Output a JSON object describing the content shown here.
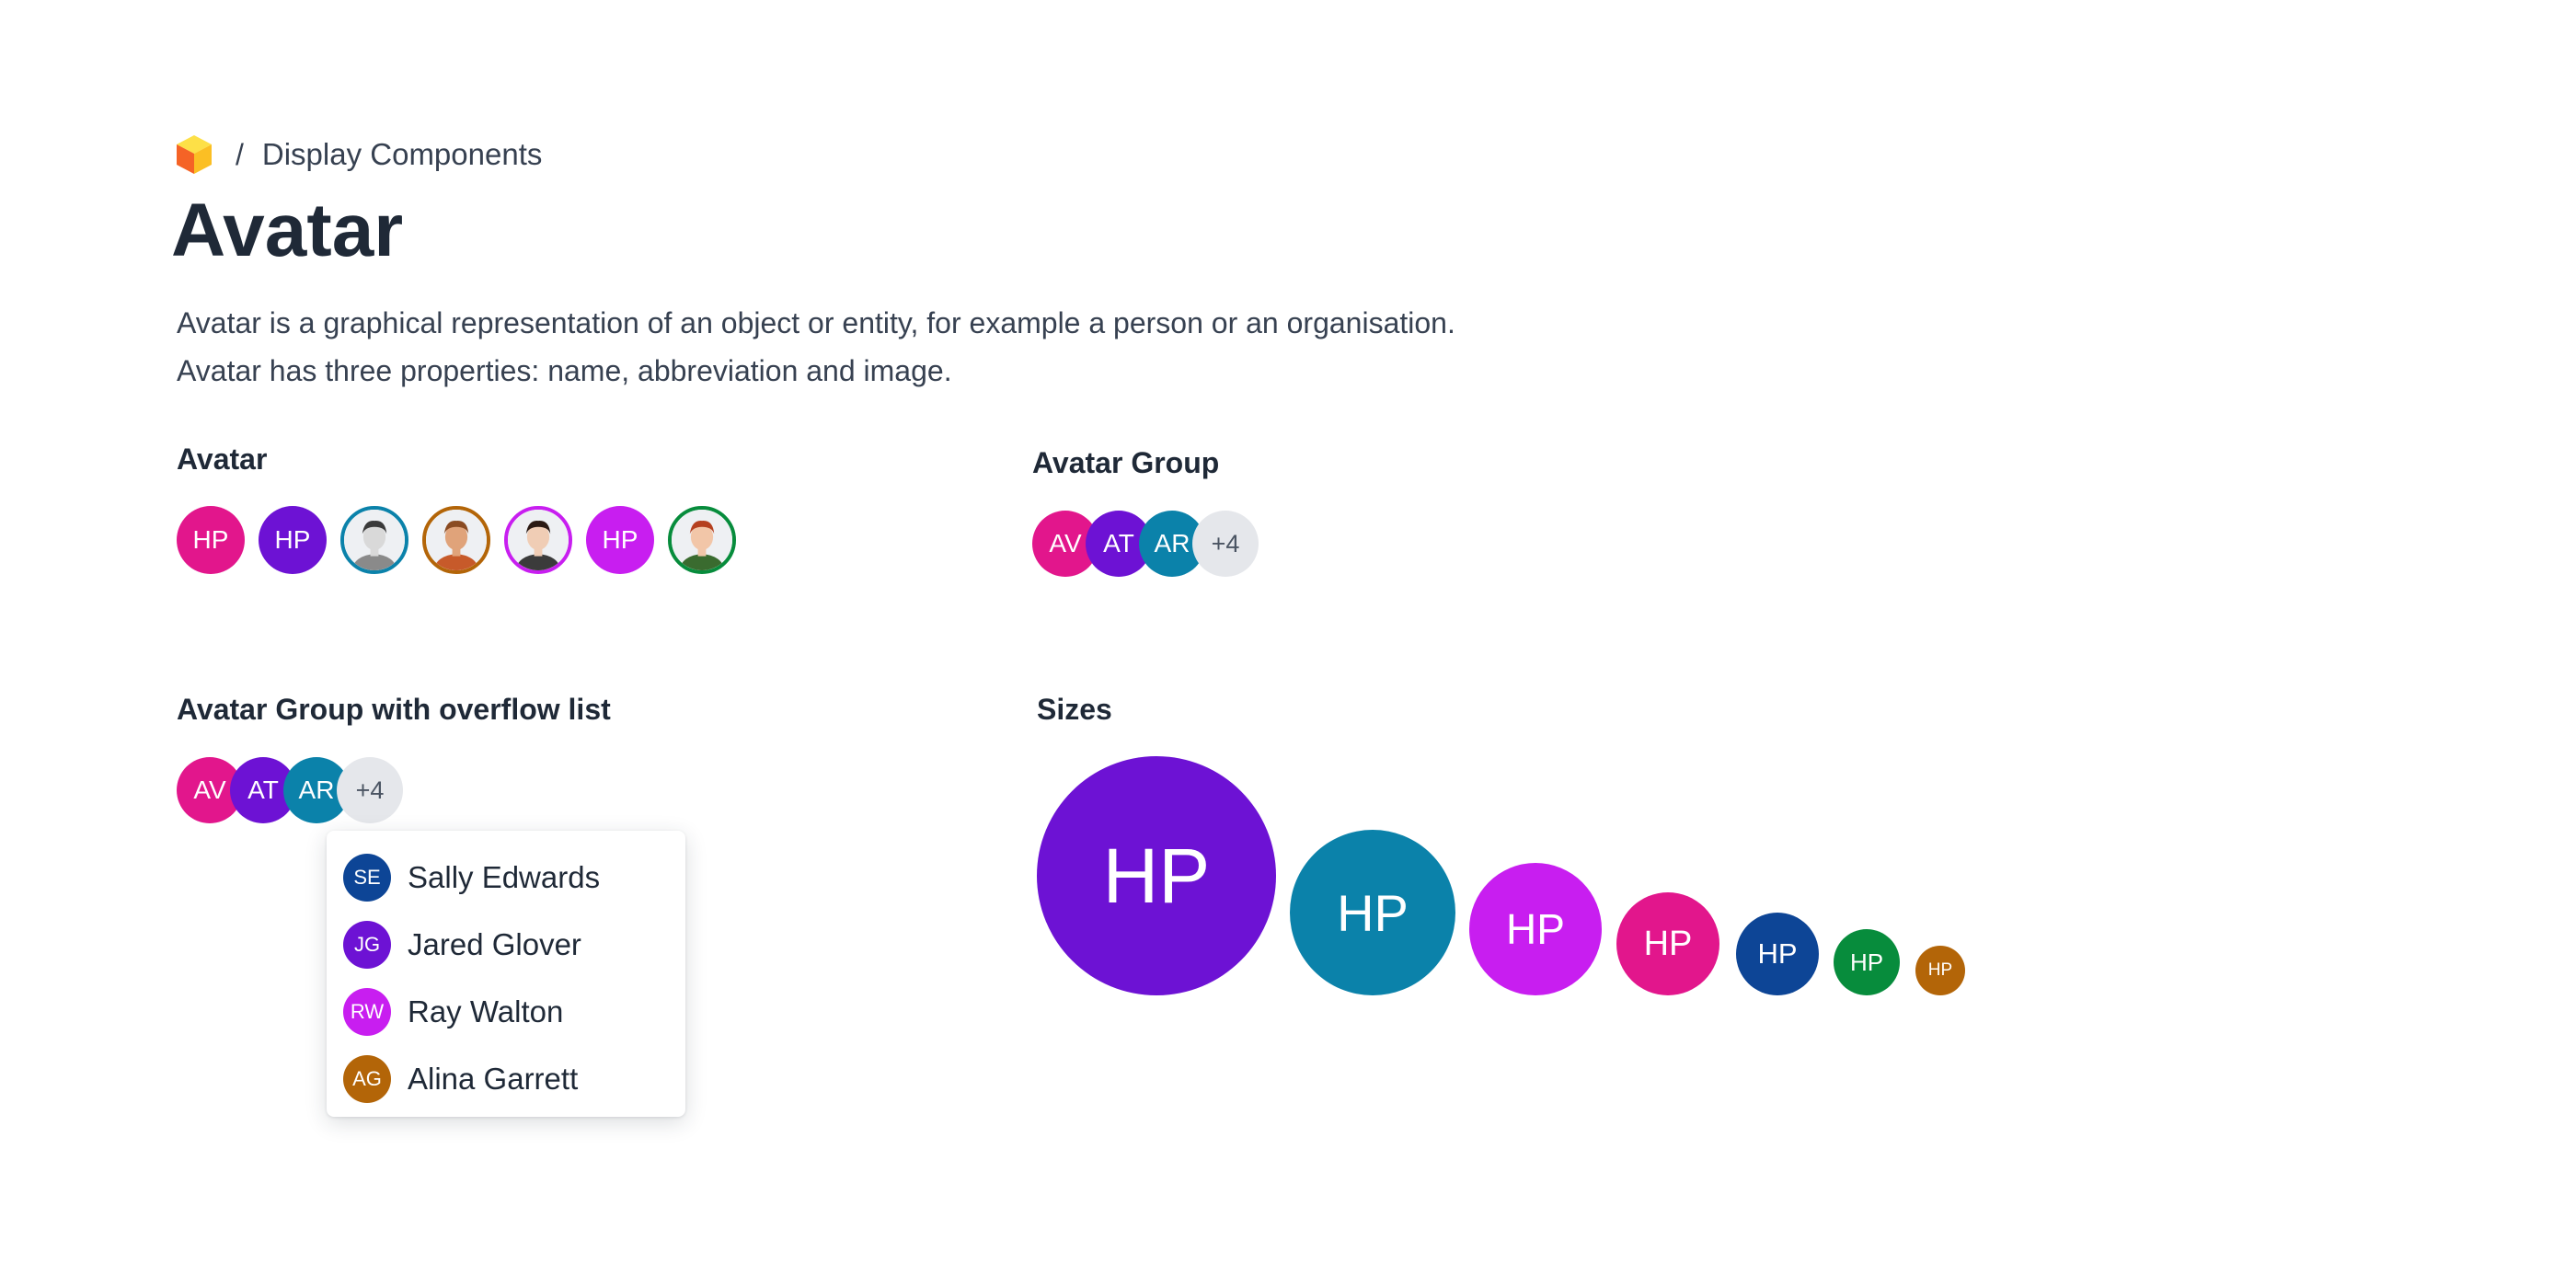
{
  "breadcrumb": {
    "logo_icon": "cube-logo-icon",
    "separator": "/",
    "section": "Display Components"
  },
  "page": {
    "title": "Avatar",
    "description_line1": "Avatar is a graphical representation of an object or entity, for example a person or an organisation.",
    "description_line2": "Avatar has three properties: name, abbreviation and image."
  },
  "colors": {
    "pink": "#e2168c",
    "purple": "#6d12d4",
    "teal": "#0b82aa",
    "magenta": "#c81ef0",
    "navy": "#0d4596",
    "green": "#078c3c",
    "amber": "#b36508",
    "gray_bg": "#e5e7eb"
  },
  "avatar_section": {
    "title": "Avatar",
    "avatars": [
      {
        "type": "initials",
        "abbr": "HP",
        "color": "#e2168c"
      },
      {
        "type": "initials",
        "abbr": "HP",
        "color": "#6d12d4"
      },
      {
        "type": "image",
        "icon": "person-photo-icon",
        "border": "#0b82aa"
      },
      {
        "type": "image",
        "icon": "person-photo-icon",
        "border": "#b36508"
      },
      {
        "type": "image",
        "icon": "person-photo-icon",
        "border": "#c81ef0"
      },
      {
        "type": "initials",
        "abbr": "HP",
        "color": "#c81ef0"
      },
      {
        "type": "image",
        "icon": "person-photo-icon",
        "border": "#078c3c"
      }
    ]
  },
  "avatar_group_section": {
    "title": "Avatar Group",
    "avatars": [
      {
        "abbr": "AV",
        "color": "#e2168c"
      },
      {
        "abbr": "AT",
        "color": "#6d12d4"
      },
      {
        "abbr": "AR",
        "color": "#0b82aa"
      }
    ],
    "overflow": "+4"
  },
  "overflow_section": {
    "title": "Avatar Group with overflow list",
    "avatars": [
      {
        "abbr": "AV",
        "color": "#e2168c"
      },
      {
        "abbr": "AT",
        "color": "#6d12d4"
      },
      {
        "abbr": "AR",
        "color": "#0b82aa"
      }
    ],
    "overflow": "+4",
    "overflow_list": [
      {
        "abbr": "SE",
        "name": "Sally Edwards",
        "color": "#0d4596"
      },
      {
        "abbr": "JG",
        "name": "Jared Glover",
        "color": "#6d12d4"
      },
      {
        "abbr": "RW",
        "name": "Ray Walton",
        "color": "#c81ef0"
      },
      {
        "abbr": "AG",
        "name": "Alina Garrett",
        "color": "#b36508"
      }
    ]
  },
  "sizes_section": {
    "title": "Sizes",
    "avatars": [
      {
        "abbr": "HP",
        "color": "#6d12d4"
      },
      {
        "abbr": "HP",
        "color": "#0b82aa"
      },
      {
        "abbr": "HP",
        "color": "#c81ef0"
      },
      {
        "abbr": "HP",
        "color": "#e2168c"
      },
      {
        "abbr": "HP",
        "color": "#0d4596"
      },
      {
        "abbr": "HP",
        "color": "#078c3c"
      },
      {
        "abbr": "HP",
        "color": "#b36508"
      }
    ]
  }
}
